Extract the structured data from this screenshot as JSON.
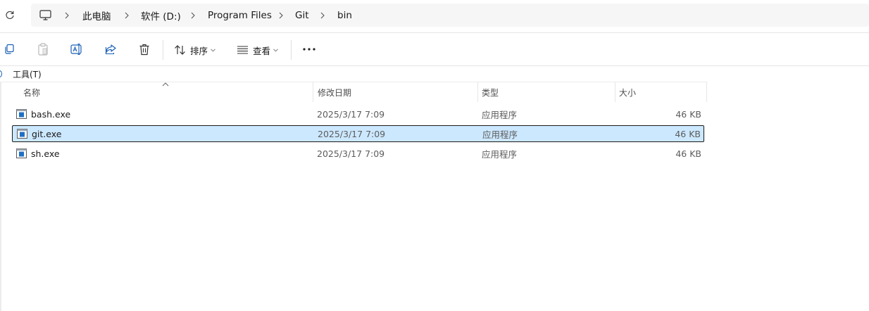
{
  "address_bar": {
    "crumbs": [
      "此电脑",
      "软件 (D:)",
      "Program Files",
      "Git",
      "bin"
    ],
    "icon": "computer-icon"
  },
  "toolbar": {
    "sort_label": "排序",
    "view_label": "查看",
    "icons": [
      "copy-icon",
      "paste-icon",
      "rename-icon",
      "share-icon",
      "delete-icon",
      "sort-icon",
      "view-icon",
      "more-icon"
    ]
  },
  "menu": {
    "tools": "工具(T)"
  },
  "columns": {
    "name": "名称",
    "modified": "修改日期",
    "type": "类型",
    "size": "大小"
  },
  "files": [
    {
      "name": "bash.exe",
      "modified": "2025/3/17 7:09",
      "type": "应用程序",
      "size": "46 KB",
      "selected": false
    },
    {
      "name": "git.exe",
      "modified": "2025/3/17 7:09",
      "type": "应用程序",
      "size": "46 KB",
      "selected": true
    },
    {
      "name": "sh.exe",
      "modified": "2025/3/17 7:09",
      "type": "应用程序",
      "size": "46 KB",
      "selected": false
    }
  ],
  "colors": {
    "selection_bg": "#cce8ff",
    "accent": "#1a5fb4"
  }
}
